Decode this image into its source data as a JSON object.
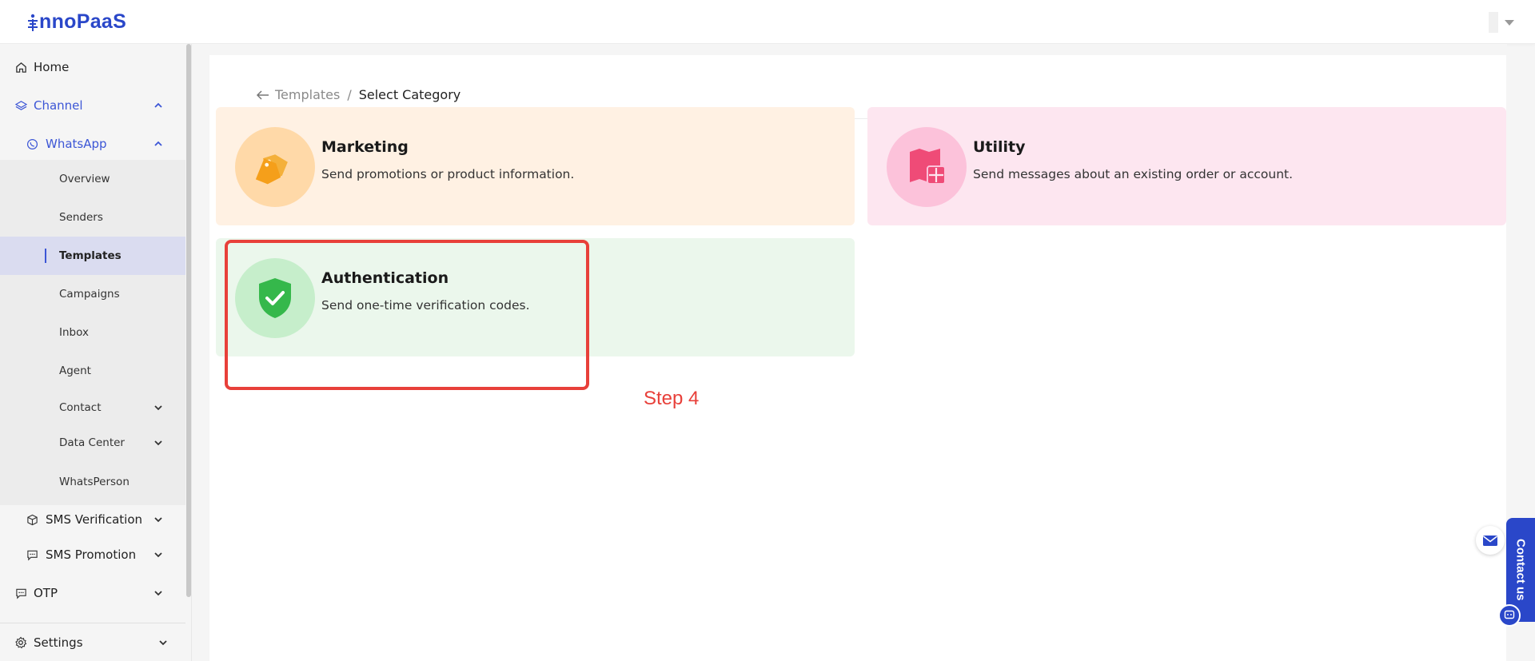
{
  "header": {
    "logo_text": "nnoPaaS",
    "brand_color": "#2a47c9"
  },
  "sidebar": {
    "home": "Home",
    "channel": "Channel",
    "whatsapp": "WhatsApp",
    "whatsapp_items": [
      "Overview",
      "Senders",
      "Templates",
      "Campaigns",
      "Inbox",
      "Agent",
      "Contact",
      "Data Center",
      "WhatsPerson"
    ],
    "active_item": "Templates",
    "sms_verification": "SMS Verification",
    "sms_promotion": "SMS Promotion",
    "otp": "OTP",
    "settings": "Settings"
  },
  "breadcrumb": {
    "parent": "Templates",
    "separator": "/",
    "current": "Select Category"
  },
  "categories": [
    {
      "title": "Marketing",
      "description": "Send promotions or product information.",
      "bg": "#fff1e3",
      "circle": "#ffd9a8",
      "icon": "tag-icon"
    },
    {
      "title": "Utility",
      "description": "Send messages about an existing order or account.",
      "bg": "#fde6f0",
      "circle": "#fcc2da",
      "icon": "map-icon"
    },
    {
      "title": "Authentication",
      "description": "Send one-time verification codes.",
      "bg": "#ebf7ec",
      "circle": "#c6eecb",
      "icon": "shield-check-icon"
    }
  ],
  "annotation": {
    "step_label": "Step 4",
    "color": "#e8403a"
  },
  "contact": {
    "label": "Contact us"
  }
}
